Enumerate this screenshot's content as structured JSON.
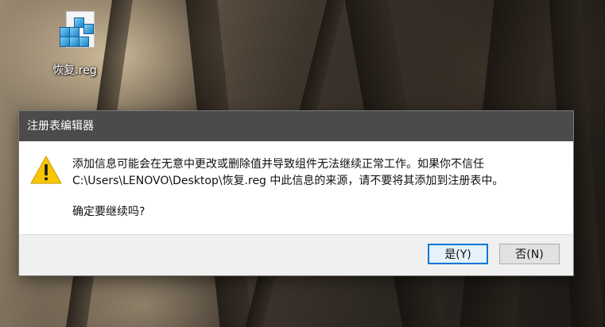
{
  "desktop": {
    "icon": {
      "label": "恢复.reg",
      "icon_name": "registry-file-icon"
    }
  },
  "dialog": {
    "title": "注册表编辑器",
    "icon_name": "warning-icon",
    "message_line1": "添加信息可能会在无意中更改或删除值并导致组件无法继续正常工作。如果你不信任",
    "message_line2": "C:\\Users\\LENOVO\\Desktop\\恢复.reg 中此信息的来源，请不要将其添加到注册表中。",
    "question": "确定要继续吗?",
    "buttons": {
      "yes": "是(Y)",
      "no": "否(N)"
    }
  },
  "colors": {
    "title_bar": "#4b4b4b",
    "default_button_border": "#0078d7",
    "warning_yellow": "#f7c600"
  }
}
